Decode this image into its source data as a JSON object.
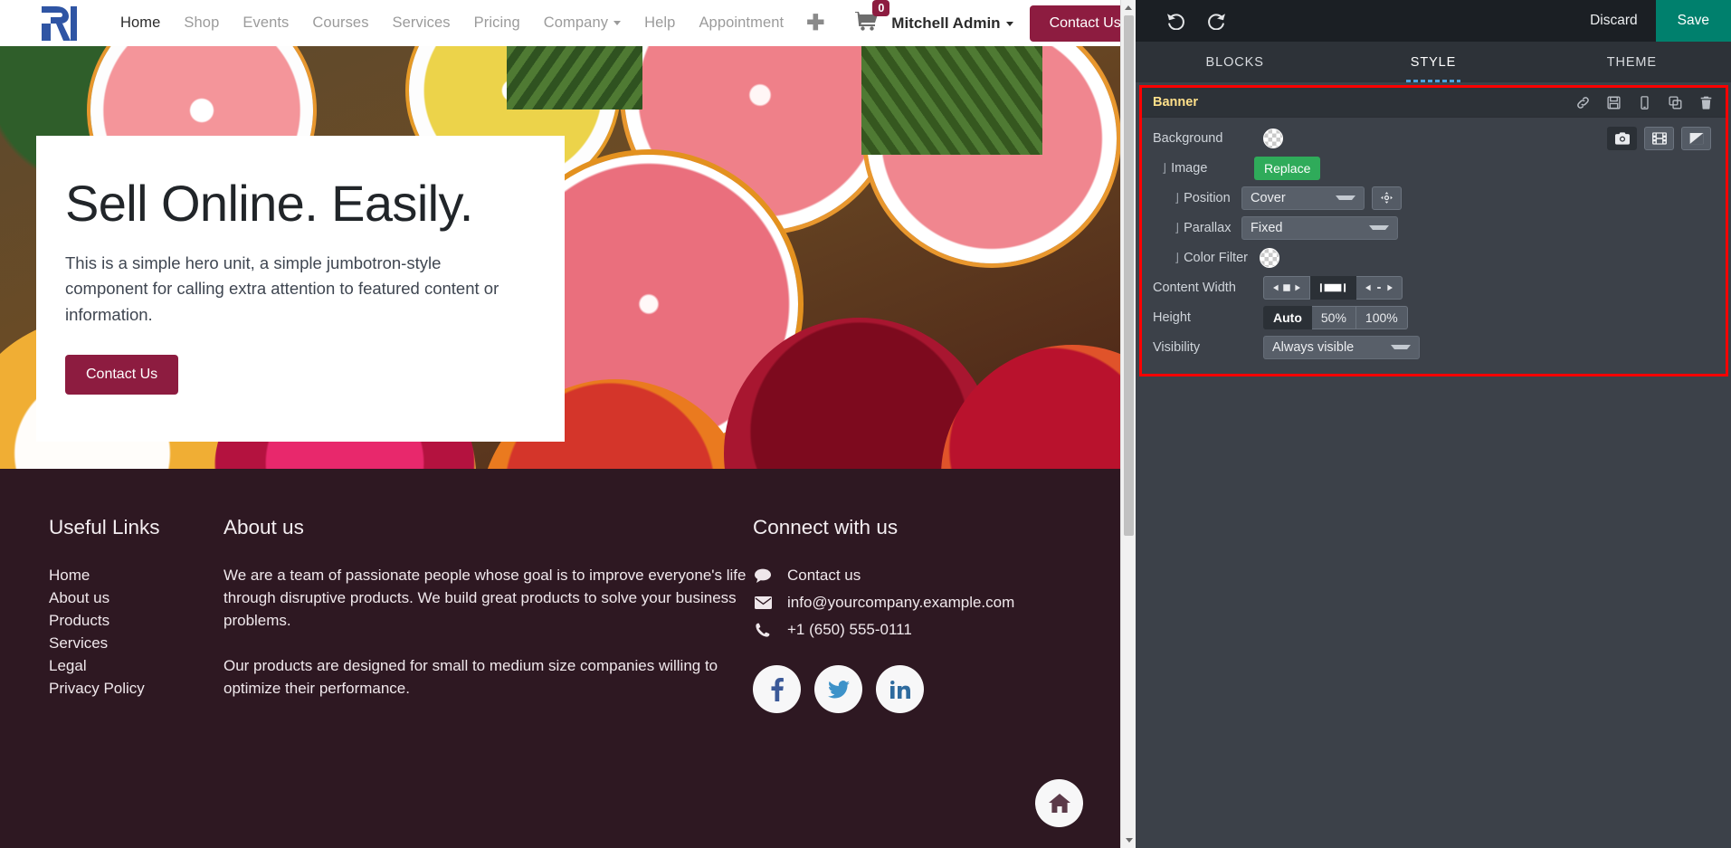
{
  "website": {
    "navbar": {
      "logo_icon": "company-logo-icon",
      "links": [
        {
          "label": "Home",
          "active": true,
          "dropdown": false
        },
        {
          "label": "Shop",
          "active": false,
          "dropdown": false
        },
        {
          "label": "Events",
          "active": false,
          "dropdown": false
        },
        {
          "label": "Courses",
          "active": false,
          "dropdown": false
        },
        {
          "label": "Services",
          "active": false,
          "dropdown": false
        },
        {
          "label": "Pricing",
          "active": false,
          "dropdown": false
        },
        {
          "label": "Company",
          "active": false,
          "dropdown": true
        },
        {
          "label": "Help",
          "active": false,
          "dropdown": false
        },
        {
          "label": "Appointment",
          "active": false,
          "dropdown": false
        }
      ],
      "add_page_icon": "plus-icon",
      "cart_icon": "shopping-cart-icon",
      "cart_count": "0",
      "user_name": "Mitchell Admin",
      "contact_button": "Contact Us"
    },
    "hero": {
      "title": "Sell Online. Easily.",
      "subtitle": "This is a simple hero unit, a simple jumbotron-style component for calling extra attention to featured content or information.",
      "button": "Contact Us"
    },
    "footer": {
      "useful_links": {
        "heading": "Useful Links",
        "items": [
          "Home",
          "About us",
          "Products",
          "Services",
          "Legal",
          "Privacy Policy"
        ]
      },
      "about": {
        "heading": "About us",
        "paragraphs": [
          "We are a team of passionate people whose goal is to improve everyone's life through disruptive products. We build great products to solve your business problems.",
          "Our products are designed for small to medium size companies willing to optimize their performance."
        ]
      },
      "connect": {
        "heading": "Connect with us",
        "rows": [
          {
            "icon": "comment-icon",
            "label": "Contact us"
          },
          {
            "icon": "envelope-icon",
            "label": "info@yourcompany.example.com"
          },
          {
            "icon": "phone-icon",
            "label": "+1 (650) 555-0111"
          }
        ],
        "socials": [
          {
            "icon": "facebook-icon",
            "label": "f"
          },
          {
            "icon": "twitter-icon",
            "label": "t"
          },
          {
            "icon": "linkedin-icon",
            "label": "in"
          }
        ]
      },
      "home_fab_icon": "home-icon"
    },
    "scrollbar": {
      "up_icon": "scroll-up-arrow",
      "down_icon": "scroll-down-arrow"
    }
  },
  "editor": {
    "toolbar": {
      "undo_icon": "undo-icon",
      "redo_icon": "redo-icon",
      "discard_label": "Discard",
      "save_label": "Save"
    },
    "tabs": [
      {
        "label": "BLOCKS",
        "active": false
      },
      {
        "label": "STYLE",
        "active": true
      },
      {
        "label": "THEME",
        "active": false
      }
    ],
    "options": {
      "title": "Banner",
      "header_icons": [
        {
          "name": "anchor-link-icon"
        },
        {
          "name": "save-snippet-icon"
        },
        {
          "name": "mobile-preview-icon"
        },
        {
          "name": "duplicate-icon"
        },
        {
          "name": "delete-icon"
        }
      ],
      "rows": {
        "background": {
          "label": "Background",
          "swatch": "transparent-color-swatch",
          "buttons": [
            {
              "name": "image-button",
              "icon": "camera-icon",
              "active": false
            },
            {
              "name": "video-button",
              "icon": "film-icon",
              "active": false
            },
            {
              "name": "shape-button",
              "icon": "shape-icon",
              "active": false
            }
          ]
        },
        "image": {
          "label": "Image",
          "button": "Replace"
        },
        "position": {
          "label": "Position",
          "value": "Cover",
          "target_icon": "drag-position-icon"
        },
        "parallax": {
          "label": "Parallax",
          "value": "Fixed"
        },
        "color_filter": {
          "label": "Color Filter",
          "swatch": "transparent-color-swatch"
        },
        "content_width": {
          "label": "Content Width",
          "options": [
            {
              "name": "width-narrow",
              "icon": "arrows-inward-icon",
              "active": false
            },
            {
              "name": "width-normal",
              "icon": "boxed-icon",
              "active": true
            },
            {
              "name": "width-full",
              "icon": "arrows-outward-icon",
              "active": false
            }
          ]
        },
        "height": {
          "label": "Height",
          "options": [
            {
              "label": "Auto",
              "active": true
            },
            {
              "label": "50%",
              "active": false
            },
            {
              "label": "100%",
              "active": false
            }
          ]
        },
        "visibility": {
          "label": "Visibility",
          "value": "Always visible"
        }
      }
    }
  },
  "colors": {
    "brand": "#8d1c40",
    "save_green": "#00806d",
    "replace_green": "#2fab5a",
    "highlight_red": "#ff0000",
    "panel_bg": "#3c4149",
    "panel_header_bg": "#2d3238",
    "toolbar_bg": "#1b1f24",
    "footer_bg": "#2e1822",
    "tab_underline": "#4aa3df",
    "option_title": "#ffe08a"
  }
}
